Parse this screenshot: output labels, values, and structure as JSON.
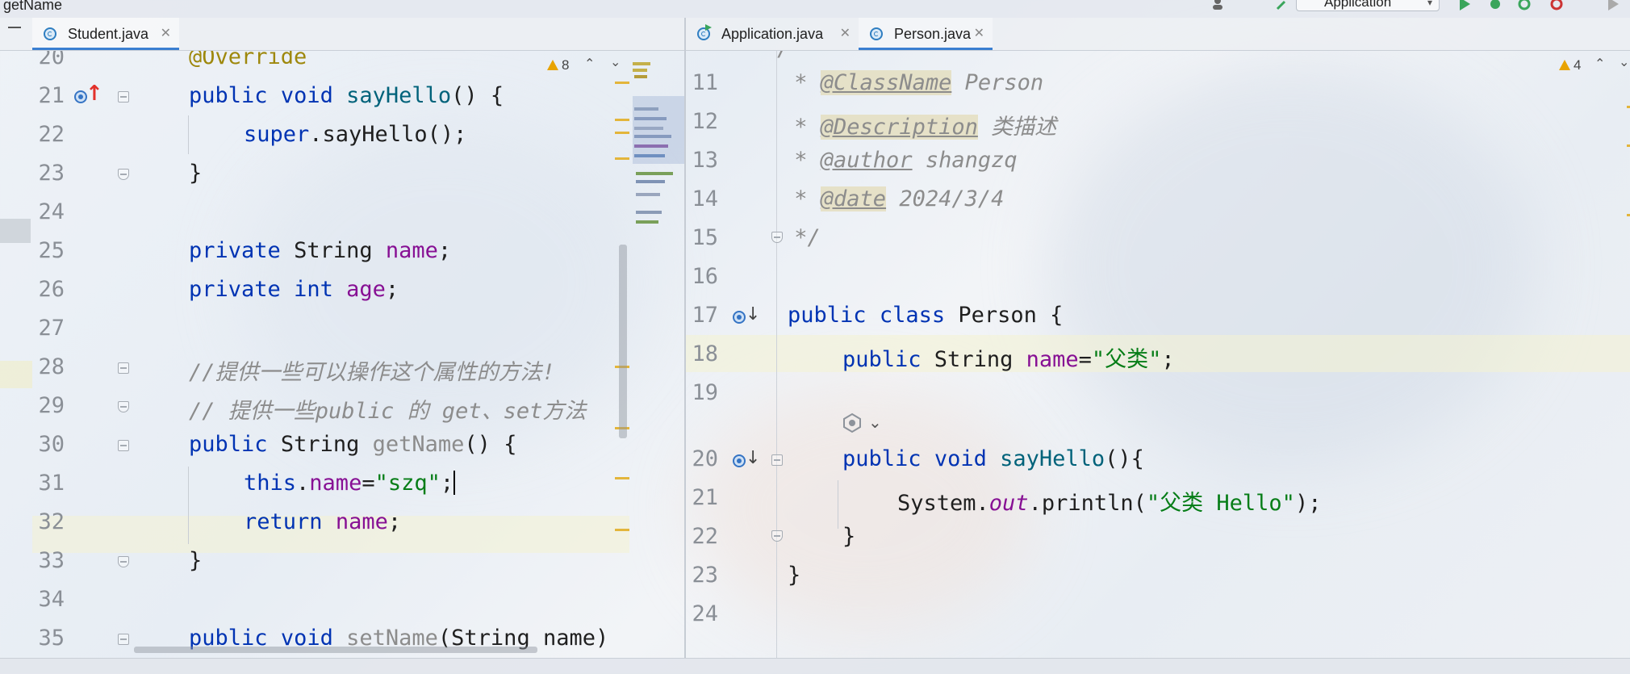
{
  "window": {
    "top_title": "getName",
    "run_config": "Application"
  },
  "left_tabs": [
    {
      "label": "Student.java",
      "active": true
    }
  ],
  "right_tabs": [
    {
      "label": "Application.java",
      "active": false
    },
    {
      "label": "Person.java",
      "active": true
    }
  ],
  "left_editor": {
    "warnings": "8",
    "lines": [
      {
        "n": "20"
      },
      {
        "n": "21"
      },
      {
        "n": "22"
      },
      {
        "n": "23"
      },
      {
        "n": "24"
      },
      {
        "n": "25"
      },
      {
        "n": "26"
      },
      {
        "n": "27"
      },
      {
        "n": "28"
      },
      {
        "n": "29"
      },
      {
        "n": "30"
      },
      {
        "n": "31"
      },
      {
        "n": "32"
      },
      {
        "n": "33"
      },
      {
        "n": "34"
      },
      {
        "n": "35"
      }
    ],
    "code": {
      "l20_ann": "@Override",
      "l21_kw1": "public",
      "l21_kw2": "void",
      "l21_name": "sayHello",
      "l21_rest": "() {",
      "l22_kw": "super",
      "l22_rest": ".sayHello();",
      "l23": "}",
      "l25_kw": "private",
      "l25_type": "String",
      "l25_fld": "name",
      "l25_end": ";",
      "l26_kw1": "private",
      "l26_kw2": "int",
      "l26_fld": "age",
      "l26_end": ";",
      "l28_cmt": "//提供一些可以操作这个属性的方法!",
      "l29_cmt": "// 提供一些public 的 get、set方法",
      "l30_kw": "public",
      "l30_type": "String",
      "l30_name": "getName",
      "l30_rest": "() {",
      "l31_kw": "this",
      "l31_dot": ".",
      "l31_fld": "name",
      "l31_eq": "=",
      "l31_str": "\"szq\"",
      "l31_end": ";",
      "l32_kw": "return",
      "l32_fld": "name",
      "l32_end": ";",
      "l33": "}",
      "l35_kw1": "public",
      "l35_kw2": "void",
      "l35_name": "setName",
      "l35_rest": "(String name)"
    }
  },
  "right_editor": {
    "warnings": "4",
    "lines": [
      {
        "n": "11"
      },
      {
        "n": "12"
      },
      {
        "n": "13"
      },
      {
        "n": "14"
      },
      {
        "n": "15"
      },
      {
        "n": "16"
      },
      {
        "n": "17"
      },
      {
        "n": "18"
      },
      {
        "n": "19"
      },
      {
        "n": "20"
      },
      {
        "n": "21"
      },
      {
        "n": "22"
      },
      {
        "n": "23"
      },
      {
        "n": "24"
      }
    ],
    "code": {
      "l11_star": " * ",
      "l11_tag": "@ClassName",
      "l11_val": " Person",
      "l12_star": " * ",
      "l12_tag": "@Description",
      "l12_val": " 类描述",
      "l13_star": " * ",
      "l13_tag": "@author",
      "l13_val": " shangzq",
      "l14_star": " * ",
      "l14_tag": "@date",
      "l14_val": " 2024/3/4",
      "l15": " */",
      "l17_kw1": "public",
      "l17_kw2": "class",
      "l17_rest": " Person {",
      "l18_kw": "public",
      "l18_type": " String ",
      "l18_fld": "name",
      "l18_eq": "=",
      "l18_str": "\"父类\"",
      "l18_end": ";",
      "l20_kw1": "public",
      "l20_kw2": "void",
      "l20_name": "sayHello",
      "l20_rest": "(){",
      "l21_obj": "System.",
      "l21_static": "out",
      "l21_call": ".println(",
      "l21_str": "\"父类 Hello\"",
      "l21_end": ");",
      "l22": "}",
      "l23": "}"
    }
  },
  "colors": {
    "keyword": "#0033b3",
    "field": "#871094",
    "string": "#067d17",
    "comment": "#8c8c8c",
    "annotation": "#9e880d",
    "active_tab_underline": "#3b7fd1"
  }
}
